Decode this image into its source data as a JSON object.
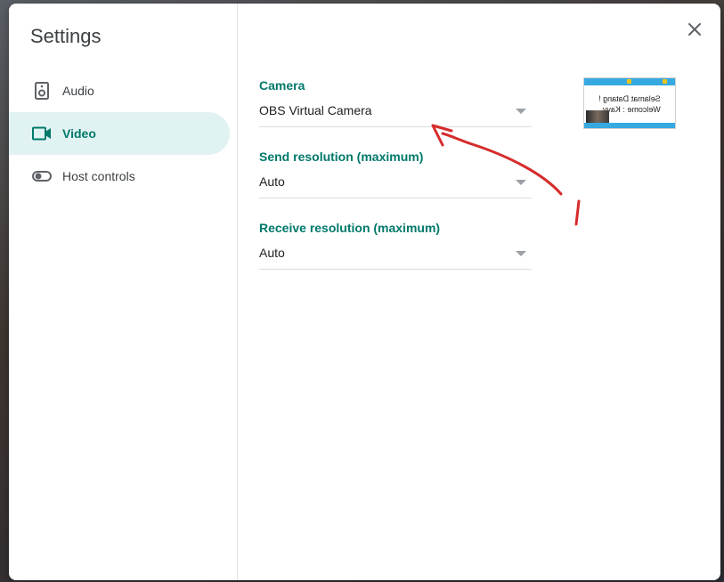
{
  "dialog": {
    "title": "Settings"
  },
  "sidebar": {
    "items": [
      {
        "label": "Audio",
        "icon": "speaker-icon"
      },
      {
        "label": "Video",
        "icon": "videocam-icon",
        "active": true
      },
      {
        "label": "Host controls",
        "icon": "toggle-icon"
      }
    ]
  },
  "video_settings": {
    "camera": {
      "label": "Camera",
      "value": "OBS Virtual Camera"
    },
    "send_resolution": {
      "label": "Send resolution (maximum)",
      "value": "Auto"
    },
    "receive_resolution": {
      "label": "Receive resolution (maximum)",
      "value": "Auto"
    }
  },
  "preview": {
    "mirrored_text_line1": "Selamat Datang !",
    "mirrored_text_line2": "Welcome : Kavv..."
  },
  "colors": {
    "accent": "#00796b",
    "active_nav_bg": "#e0f2f1",
    "annotation": "#d62b2b"
  }
}
